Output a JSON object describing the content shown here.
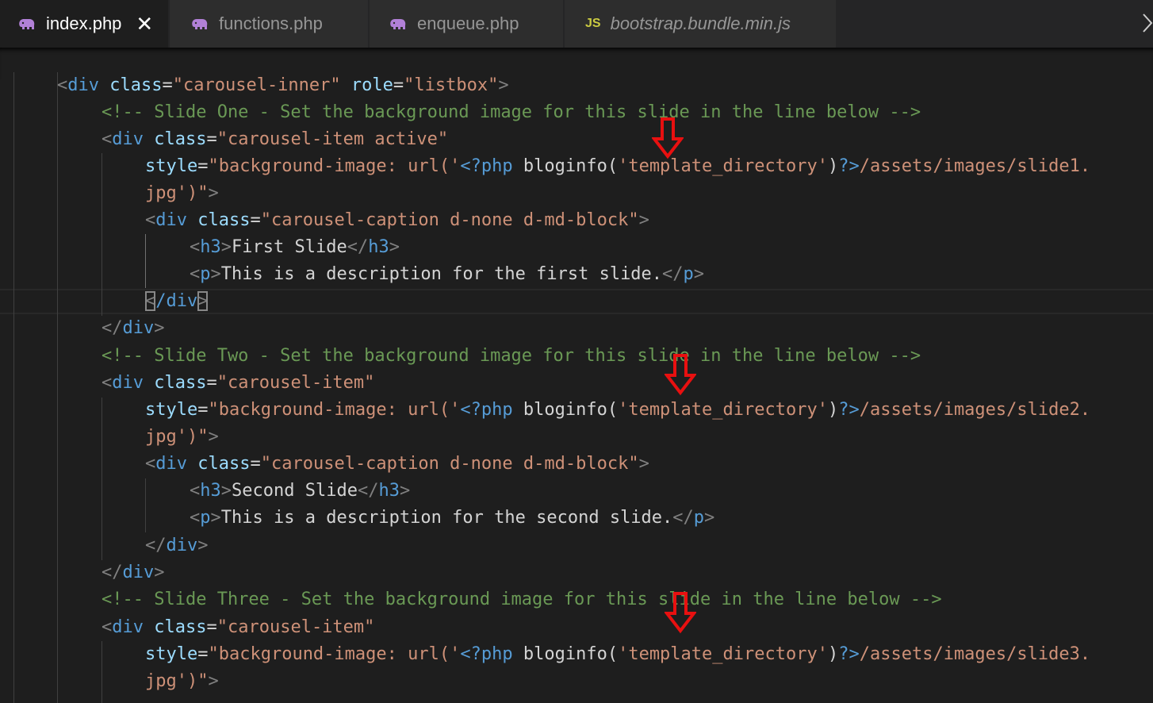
{
  "tabs": [
    {
      "label": "index.php",
      "icon": "php-elephant-icon",
      "active": true
    },
    {
      "label": "functions.php",
      "icon": "php-elephant-icon",
      "active": false
    },
    {
      "label": "enqueue.php",
      "icon": "php-elephant-icon",
      "active": false
    },
    {
      "label": "bootstrap.bundle.min.js",
      "icon": "js-icon",
      "icon_text": "JS",
      "active": false
    }
  ],
  "close_glyph": "✕",
  "colors": {
    "tag": "#569cd6",
    "attr": "#9cdcfe",
    "string": "#ce9178",
    "comment": "#6a9955",
    "text": "#d4d4d4",
    "arrow": "#e81010",
    "php_icon": "#b180d7",
    "js_icon": "#cbcb41"
  },
  "code": {
    "l1": {
      "a": "<",
      "b": "div",
      "c": "class",
      "d": "=",
      "e": "\"carousel-inner\"",
      "f": "role",
      "g": "=",
      "h": "\"listbox\"",
      "i": ">"
    },
    "l2": {
      "a": "<!-- Slide One - Set the background image for this slide in the line below -->"
    },
    "l3": {
      "a": "<",
      "b": "div",
      "c": "class",
      "d": "=",
      "e": "\"carousel-item active\""
    },
    "l4": {
      "a": "style",
      "b": "=",
      "c": "\"background-image: url('",
      "d": "<?php",
      "e": "bloginfo(",
      "f": "'template_directory'",
      "g": ")",
      "h": "?>",
      "i": "/assets/images/slide1."
    },
    "l5": {
      "a": "jpg')\"",
      "b": ">"
    },
    "l6": {
      "a": "<",
      "b": "div",
      "c": "class",
      "d": "=",
      "e": "\"carousel-caption d-none d-md-block\"",
      "f": ">"
    },
    "l7": {
      "a": "<",
      "b": "h3",
      "c": ">",
      "d": "First Slide",
      "e": "</",
      "f": "h3",
      "g": ">"
    },
    "l8": {
      "a": "<",
      "b": "p",
      "c": ">",
      "d": "This is a description for the first slide.",
      "e": "</",
      "f": "p",
      "g": ">"
    },
    "l9": {
      "a": "<",
      "b": "/div",
      "c": ">"
    },
    "l10": {
      "a": "</",
      "b": "div",
      "c": ">"
    },
    "l11": {
      "a": "<!-- Slide Two - Set the background image for this slide in the line below -->"
    },
    "l12": {
      "a": "<",
      "b": "div",
      "c": "class",
      "d": "=",
      "e": "\"carousel-item\""
    },
    "l13": {
      "a": "style",
      "b": "=",
      "c": "\"background-image: url('",
      "d": "<?php",
      "e": "bloginfo(",
      "f": "'template_directory'",
      "g": ")",
      "h": "?>",
      "i": "/assets/images/slide2."
    },
    "l14": {
      "a": "jpg')\"",
      "b": ">"
    },
    "l15": {
      "a": "<",
      "b": "div",
      "c": "class",
      "d": "=",
      "e": "\"carousel-caption d-none d-md-block\"",
      "f": ">"
    },
    "l16": {
      "a": "<",
      "b": "h3",
      "c": ">",
      "d": "Second Slide",
      "e": "</",
      "f": "h3",
      "g": ">"
    },
    "l17": {
      "a": "<",
      "b": "p",
      "c": ">",
      "d": "This is a description for the second slide.",
      "e": "</",
      "f": "p",
      "g": ">"
    },
    "l18": {
      "a": "</",
      "b": "div",
      "c": ">"
    },
    "l19": {
      "a": "</",
      "b": "div",
      "c": ">"
    },
    "l20": {
      "a": "<!-- Slide Three - Set the background image for this slide in the line below -->"
    },
    "l21": {
      "a": "<",
      "b": "div",
      "c": "class",
      "d": "=",
      "e": "\"carousel-item\""
    },
    "l22": {
      "a": "style",
      "b": "=",
      "c": "\"background-image: url('",
      "d": "<?php",
      "e": "bloginfo(",
      "f": "'template_directory'",
      "g": ")",
      "h": "?>",
      "i": "/assets/images/slide3."
    },
    "l23": {
      "a": "jpg')\"",
      "b": ">"
    }
  }
}
